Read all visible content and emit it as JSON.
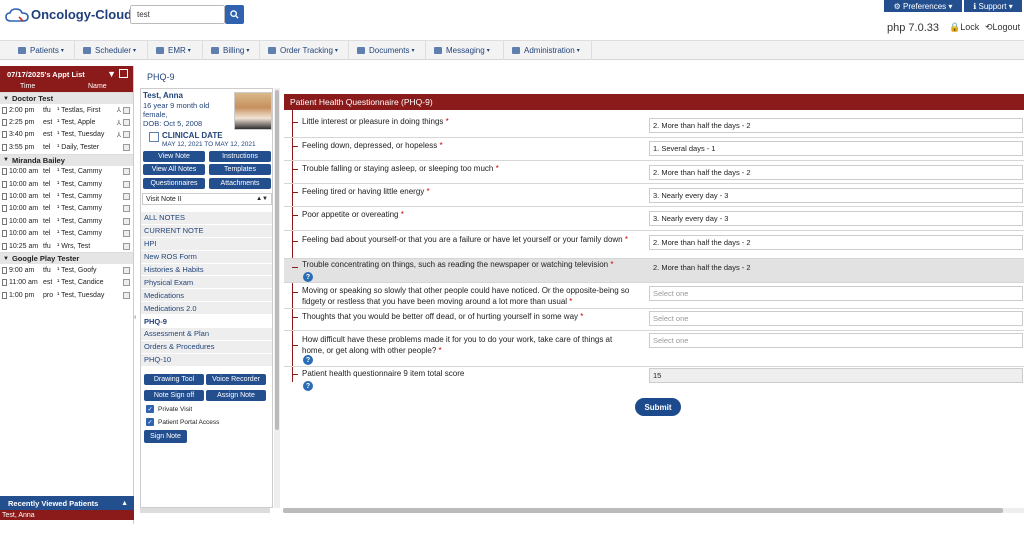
{
  "header": {
    "logo_text": "Oncology-Cloud",
    "search_value": "test",
    "preferences_label": "⚙ Preferences ▾",
    "support_label": "ℹ Support ▾",
    "version": "php 7.0.33",
    "lock_label": "🔒Lock",
    "logout_label": "⟲Logout"
  },
  "menu": [
    {
      "label": "Patients"
    },
    {
      "label": "Scheduler"
    },
    {
      "label": "EMR"
    },
    {
      "label": "Billing"
    },
    {
      "label": "Order Tracking"
    },
    {
      "label": "Documents"
    },
    {
      "label": "Messaging"
    },
    {
      "label": "Administration"
    }
  ],
  "appt_list": {
    "title": "07/17/2025's Appt List",
    "col_time": "Time",
    "col_name": "Name",
    "groups": [
      {
        "name": "Doctor Test",
        "rows": [
          {
            "time": "2:00 pm",
            "type": "tfu",
            "name": "¹ Testlas, First"
          },
          {
            "time": "2:25 pm",
            "type": "est",
            "name": "¹ Test, Apple"
          },
          {
            "time": "3:40 pm",
            "type": "est",
            "name": "¹ Test, Tuesday"
          },
          {
            "time": "3:55 pm",
            "type": "tel",
            "name": "¹ Daily, Tester"
          }
        ]
      },
      {
        "name": "Miranda Bailey",
        "rows": [
          {
            "time": "10:00 am",
            "type": "tel",
            "name": "¹ Test, Cammy"
          },
          {
            "time": "10:00 am",
            "type": "tel",
            "name": "¹ Test, Cammy"
          },
          {
            "time": "10:00 am",
            "type": "tel",
            "name": "¹ Test, Cammy"
          },
          {
            "time": "10:00 am",
            "type": "tel",
            "name": "¹ Test, Cammy"
          },
          {
            "time": "10:00 am",
            "type": "tel",
            "name": "¹ Test, Cammy"
          },
          {
            "time": "10:00 am",
            "type": "tel",
            "name": "¹ Test, Cammy"
          },
          {
            "time": "10:25 am",
            "type": "tfu",
            "name": "¹ Wrs, Test"
          }
        ]
      },
      {
        "name": "Google Play Tester",
        "rows": [
          {
            "time": "9:00 am",
            "type": "tfu",
            "name": "¹ Test, Goofy"
          },
          {
            "time": "11:00 am",
            "type": "est",
            "name": "¹ Test, Candice"
          },
          {
            "time": "1:00 pm",
            "type": "pro",
            "name": "¹ Test, Tuesday"
          }
        ]
      }
    ],
    "recent_title": "Recently Viewed Patients",
    "recent_items": [
      "Test, Anna"
    ]
  },
  "page_title": "PHQ-9",
  "patient": {
    "name": "Test, Anna",
    "age_line": "16 year 9 month old",
    "gender_line": "female,",
    "dob_line": "DOB: Oct 5, 2008",
    "clinical_date_title": "CLINICAL DATE",
    "clinical_date_range": "MAY 12, 2021 TO MAY 12, 2021",
    "buttons": [
      "View Note",
      "Instructions",
      "View All Notes",
      "Templates",
      "Questionnaires",
      "Attachments"
    ],
    "visit_select": "Visit Note II",
    "nav": [
      "ALL NOTES",
      "CURRENT NOTE",
      "HPI",
      "New ROS Form",
      "Histories & Habits",
      "Physical Exam",
      "Medications",
      "Medications 2.0",
      "PHQ-9",
      "Assessment & Plan",
      "Orders & Procedures",
      "PHQ-10"
    ],
    "tools": [
      "Drawing Tool",
      "Voice Recorder",
      "Note Sign off",
      "Assign Note"
    ],
    "private_visit": "Private Visit",
    "portal_access": "Patient Portal Access",
    "sign_note": "Sign Note"
  },
  "questionnaire": {
    "title": "Patient Health Questionnaire (PHQ-9)",
    "submit": "Submit",
    "items": [
      {
        "q": "Little interest or pleasure in doing things",
        "req": "*",
        "a": "2. More than half the days - 2"
      },
      {
        "q": "Feeling down, depressed, or hopeless",
        "req": "*",
        "a": "1. Several days - 1"
      },
      {
        "q": "Trouble falling or staying asleep, or sleeping too much",
        "req": "*",
        "a": "2. More than half the days - 2"
      },
      {
        "q": "Feeling tired or having little energy",
        "req": "*",
        "a": "3. Nearly every day - 3"
      },
      {
        "q": "Poor appetite or overeating",
        "req": "*",
        "a": "3. Nearly every day - 3"
      },
      {
        "q": "Feeling bad about yourself-or that you are a failure or have let yourself or your family down",
        "req": "*",
        "a": "2. More than half the days - 2"
      },
      {
        "q": "Trouble concentrating on things, such as reading the newspaper or watching television",
        "req": "*",
        "a": "2. More than half the days - 2"
      },
      {
        "q": "Moving or speaking so slowly that other people could have noticed. Or the opposite-being so fidgety or restless that you have been moving around a lot more than usual",
        "req": "*",
        "a": "Select one"
      },
      {
        "q": "Thoughts that you would be better off dead, or of hurting yourself in some way",
        "req": "*",
        "a": "Select one"
      },
      {
        "q": "How difficult have these problems made it for you to do your work, take care of things at home, or get along with other people?",
        "req": "*",
        "a": "Select one"
      },
      {
        "q": "Patient health questionnaire 9 item total score",
        "req": "",
        "a": "15"
      }
    ]
  }
}
